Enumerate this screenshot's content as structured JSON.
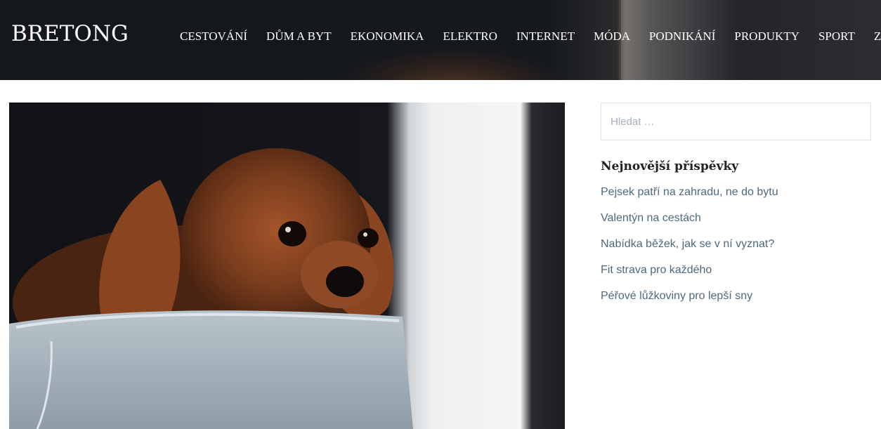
{
  "site": {
    "title": "BRETONG"
  },
  "nav": {
    "items": [
      {
        "label": "CESTOVÁNÍ"
      },
      {
        "label": "DŮM A BYT"
      },
      {
        "label": "EKONOMIKA"
      },
      {
        "label": "ELEKTRO"
      },
      {
        "label": "INTERNET"
      },
      {
        "label": "MÓDA"
      },
      {
        "label": "PODNIKÁNÍ"
      },
      {
        "label": "PRODUKTY"
      },
      {
        "label": "SPORT"
      },
      {
        "label": "ZÁBAVA"
      }
    ]
  },
  "search": {
    "placeholder": "Hledat …",
    "value": ""
  },
  "recent_posts": {
    "title": "Nejnovější příspěvky",
    "items": [
      {
        "label": "Pejsek patří na zahradu, ne do bytu"
      },
      {
        "label": "Valentýn na cestách"
      },
      {
        "label": "Nabídka běžek, jak se v ní vyznat?"
      },
      {
        "label": "Fit strava pro každého"
      },
      {
        "label": "Péřové lůžkoviny pro lepší sny"
      }
    ]
  },
  "colors": {
    "header_bg": "#15181d",
    "link": "#4d6a7d",
    "heading": "#222222"
  }
}
